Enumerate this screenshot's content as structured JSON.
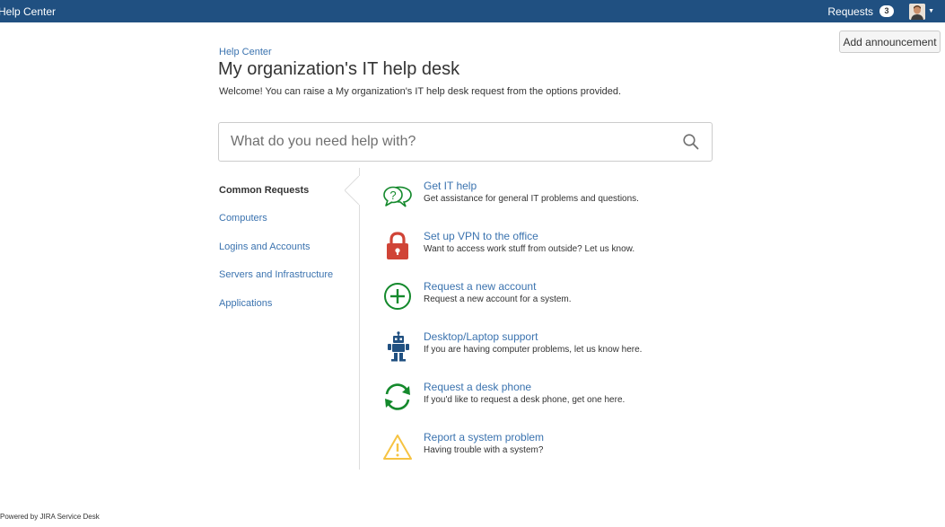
{
  "topbar": {
    "brand": "Help Center",
    "requests_label": "Requests",
    "requests_count": "3",
    "color": "#205081"
  },
  "announce_button": "Add announcement",
  "breadcrumb": "Help Center",
  "page": {
    "title": "My organization's IT help desk",
    "welcome": "Welcome! You can raise a My organization's IT help desk request from the options provided."
  },
  "search": {
    "placeholder": "What do you need help with?",
    "icon": "search-icon"
  },
  "groups": [
    {
      "label": "Common Requests",
      "active": true
    },
    {
      "label": "Computers",
      "active": false
    },
    {
      "label": "Logins and Accounts",
      "active": false
    },
    {
      "label": "Servers and Infrastructure",
      "active": false
    },
    {
      "label": "Applications",
      "active": false
    }
  ],
  "request_types": [
    {
      "title": "Get IT help",
      "description": "Get assistance for general IT problems and questions.",
      "icon": "speech-bubbles-icon",
      "color": "#14892c"
    },
    {
      "title": "Set up VPN to the office",
      "description": "Want to access work stuff from outside? Let us know.",
      "icon": "lock-icon",
      "color": "#d04437"
    },
    {
      "title": "Request a new account",
      "description": "Request a new account for a system.",
      "icon": "plus-circle-icon",
      "color": "#14892c"
    },
    {
      "title": "Desktop/Laptop support",
      "description": "If you are having computer problems, let us know here.",
      "icon": "robot-icon",
      "color": "#205081"
    },
    {
      "title": "Request a desk phone",
      "description": "If you'd like to request a desk phone, get one here.",
      "icon": "refresh-icon",
      "color": "#14892c"
    },
    {
      "title": "Report a system problem",
      "description": "Having trouble with a system?",
      "icon": "warning-icon",
      "color": "#f6c342"
    }
  ],
  "footer": "Powered by JIRA Service Desk"
}
